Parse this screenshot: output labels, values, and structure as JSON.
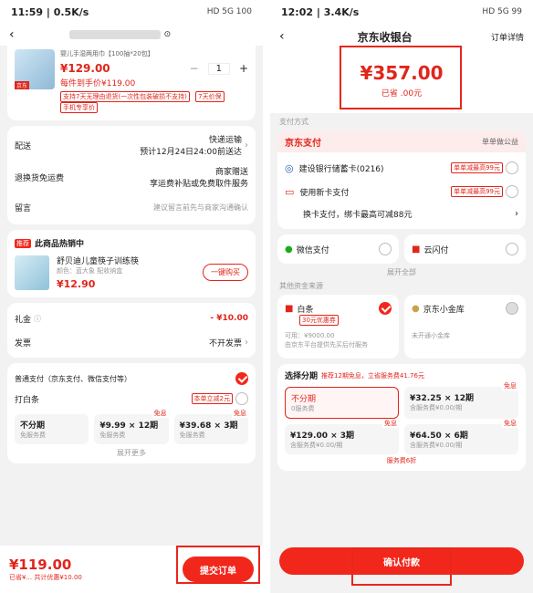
{
  "left": {
    "status": {
      "time": "11:59",
      "speed": "0.5K/s",
      "right_info": "HD 5G 100"
    },
    "header": {
      "title_blurred": "",
      "qr_icon": "qr-icon"
    },
    "product": {
      "name": "婴儿手湿两用巾【100抽*20包】",
      "price": "¥129.00",
      "qty": "1",
      "unit_price": "每件到手价¥119.00",
      "tags": [
        "支持7天无理由退货(一次性包装破损不支持)",
        "7天价保",
        "手机专享价"
      ],
      "image_badge": "京东"
    },
    "shipping": {
      "label": "配送",
      "value": "快递运输",
      "sub": "预计12月24日24:00前送达"
    },
    "return": {
      "label": "退换货免运费",
      "value": "商家赠送",
      "sub": "享运费补贴或免费取件服务"
    },
    "note": {
      "label": "留言",
      "placeholder": "建议留言前先与商家沟通确认"
    },
    "hot": {
      "badge": "推荐",
      "title": "此商品热销中",
      "item_name": "舒贝迪儿童筷子训练筷",
      "item_sub": "颜色：蓝大象 配收纳盒",
      "item_price": "¥12.90",
      "btn": "一键购买"
    },
    "gift": {
      "label": "礼金",
      "value": "- ¥10.00"
    },
    "invoice": {
      "label": "发票",
      "value": "不开发票"
    },
    "pay": {
      "general": "普通支付（京东支付、微信支付等）",
      "baitiao": "打白条",
      "baitiao_tag": "本单立减2元",
      "options": [
        {
          "title": "不分期",
          "sub": "免服务费"
        },
        {
          "title": "¥9.99 × 12期",
          "sub": "免服务费",
          "free": "免息"
        },
        {
          "title": "¥39.68 × 3期",
          "sub": "免服务费",
          "free": "免息"
        }
      ],
      "more": "展开更多"
    },
    "footer": {
      "total": "¥119.00",
      "saved": "已省¥... 共计优惠¥10.00",
      "submit": "提交订单"
    }
  },
  "right": {
    "status": {
      "time": "12:02",
      "speed": "3.4K/s",
      "right_info": "HD 5G 99"
    },
    "header": {
      "title": "京东收银台",
      "detail": "订单详情"
    },
    "amount": {
      "value": "¥357.00",
      "saved": "已省  .00元"
    },
    "method_label": "支付方式",
    "jdpay": {
      "logo": "京东支付",
      "right": "单单做公益"
    },
    "bank": [
      {
        "name": "建设银行储蓄卡(0216)",
        "tag": "单单减最高99元"
      },
      {
        "name": "使用新卡支付",
        "tag": "单单减最高99元"
      }
    ],
    "switch_card": "换卡支付，绑卡最高可减88元",
    "wechat": "微信支付",
    "unionpay": "云闪付",
    "expand": "展开全部",
    "other_label": "其他资金来源",
    "baitiao": {
      "name": "白条",
      "tag": "30元优惠券",
      "avail": "可用：¥9000.00",
      "sub": "由京东平台提供先买后付服务"
    },
    "treasury": {
      "name": "京东小金库",
      "sub": "未开通小金库"
    },
    "installment": {
      "title": "选择分期",
      "promo": "推荐12期免息，立省服务费41.76元",
      "options": [
        {
          "title": "不分期",
          "sub": "0服务费"
        },
        {
          "title": "¥32.25 × 12期",
          "sub": "含服务费¥0.00/期",
          "free": "免息"
        },
        {
          "title": "¥129.00 × 3期",
          "sub": "含服务费¥0.00/期",
          "free": "免息"
        },
        {
          "title": "¥64.50 × 6期",
          "sub": "含服务费¥0.00/期",
          "free": "免息"
        }
      ],
      "small": "服务费6折"
    },
    "confirm": "确认付款"
  }
}
